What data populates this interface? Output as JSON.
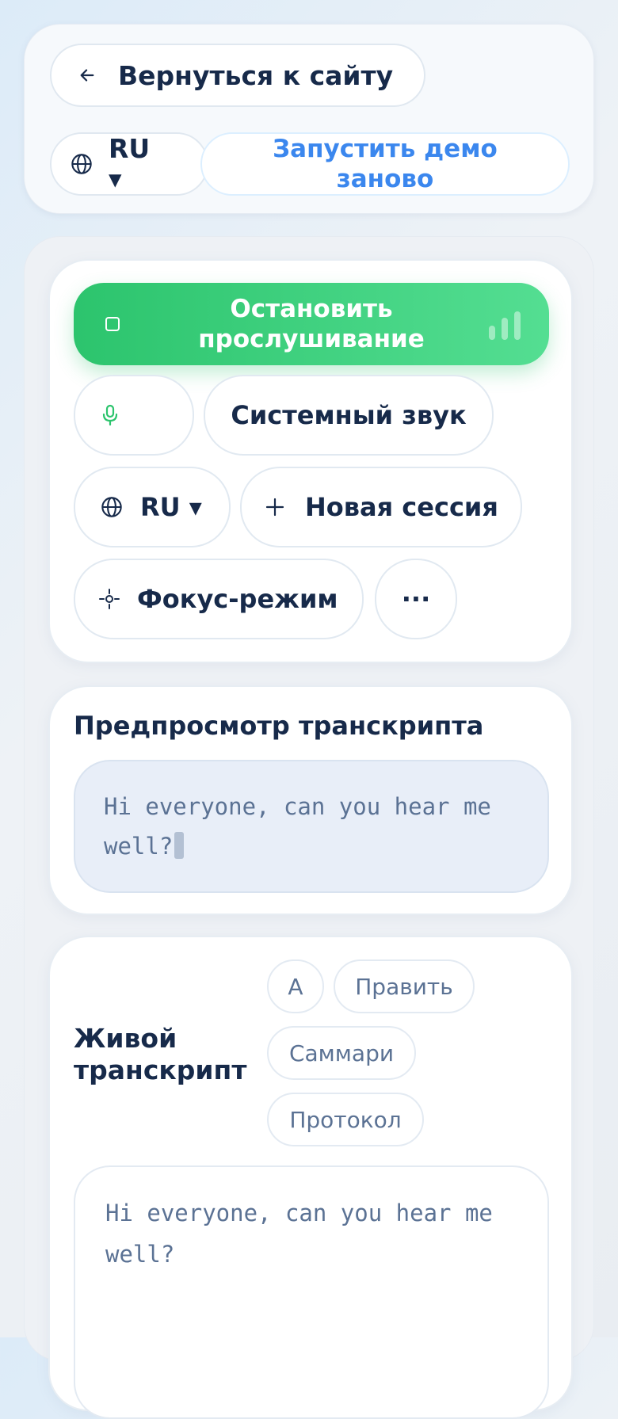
{
  "header": {
    "back_label": "Вернуться к сайту",
    "lang_label": "RU ▾",
    "restart_label": "Запустить демо заново"
  },
  "controls": {
    "stop_label": "Остановить прослушивание",
    "system_audio_label": "Системный звук",
    "lang_label": "RU ▾",
    "new_session_label": "Новая сессия",
    "focus_label": "Фокус-режим",
    "more_label": "···"
  },
  "preview": {
    "title": "Предпросмотр транскрипта",
    "text": "Hi everyone, can you hear me well?"
  },
  "live": {
    "title": "Живой транскрипт",
    "font_button": "A",
    "edit_button": "Править",
    "summary_button": "Саммари",
    "protocol_button": "Протокол",
    "text": "Hi everyone, can you hear me well?"
  },
  "colors": {
    "accent_green": "#2cc46d",
    "accent_blue": "#3b87ee",
    "text_dark": "#172a4a",
    "text_muted": "#5b7294"
  },
  "icons": [
    "arrow-left-icon",
    "globe-icon",
    "stop-icon",
    "audio-level-icon",
    "microphone-icon",
    "plus-icon",
    "focus-icon"
  ]
}
